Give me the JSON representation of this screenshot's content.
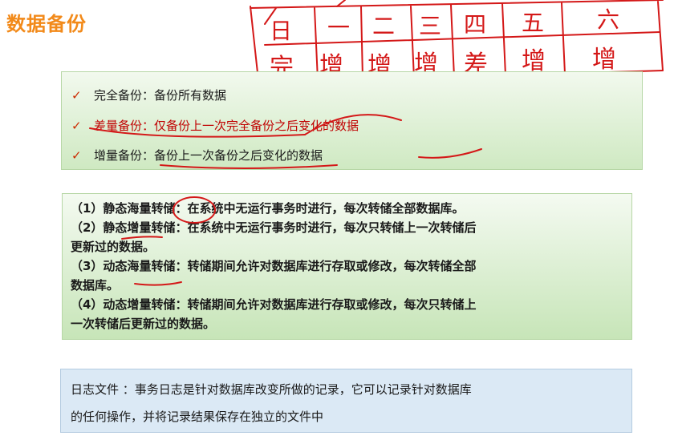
{
  "title": "数据备份",
  "annotation": {
    "days": [
      "日",
      "一",
      "二",
      "三",
      "四",
      "五",
      "六"
    ],
    "types": [
      "完",
      "增",
      "增",
      "增",
      "差",
      "增",
      "增"
    ]
  },
  "backup_types": [
    {
      "name": "完全备份：",
      "desc": "备份所有数据"
    },
    {
      "name": "差量备份：",
      "desc": "仅备份上一次完全备份之后变化的数据"
    },
    {
      "name": "增量备份：",
      "desc": "备份上一次备份之后变化的数据"
    }
  ],
  "dump_types": {
    "line1": "（1）静态海量转储：在系统中无运行事务时进行，每次转储全部数据库。",
    "line2": "（2）静态增量转储：在系统中无运行事务时进行，每次只转储上一次转储后",
    "line3": "更新过的数据。",
    "line4": "（3）动态海量转储：转储期间允许对数据库进行存取或修改，每次转储全部",
    "line5": "数据库。",
    "line6": "（4）动态增量转储：转储期间允许对数据库进行存取或修改，每次只转储上",
    "line7": "一次转储后更新过的数据。"
  },
  "log_file": {
    "line1": "日志文件 ：事务日志是针对数据库改变所做的记录，它可以记录针对数据库",
    "line2": "的任何操作，并将记录结果保存在独立的文件中"
  },
  "colors": {
    "title": "#f28a1a",
    "ink": "#d41818",
    "highlight": "#c00000"
  }
}
